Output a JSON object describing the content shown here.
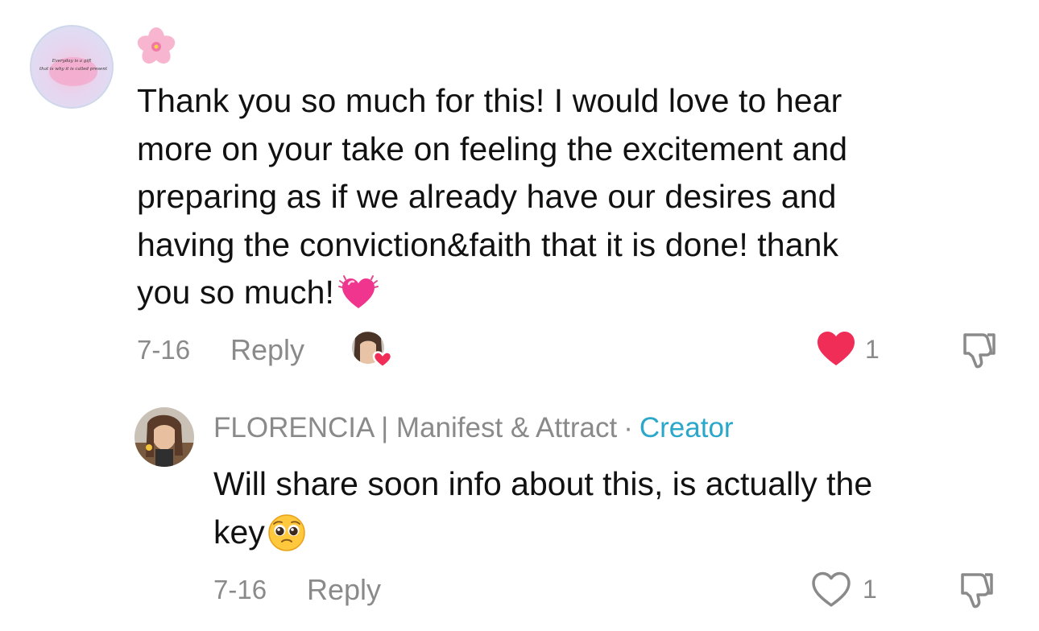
{
  "comment": {
    "avatar_text": "Everyday is a gift that is why it is called present",
    "flower_icon": "cherry-blossom-emoji",
    "lines": [
      "Thank you so much for this! I would love to hear",
      "more on your take on feeling the excitement and",
      "preparing as if we already have our desires and",
      "having the conviction&faith that it is done! thank",
      "you so much!"
    ],
    "trailing_emoji": "growing-heart-emoji",
    "date": "7-16",
    "reply_label": "Reply",
    "liked_by_creator_icon": "creator-liked-avatar",
    "like_count": "1",
    "liked": true,
    "like_color": "#ef2d56"
  },
  "reply": {
    "author": "FLORENCIA | Manifest & Attract",
    "separator": "·",
    "badge": "Creator",
    "badge_color": "#2aa7c9",
    "lines": [
      "Will share soon info about this, is actually the",
      "key"
    ],
    "trailing_emoji": "pleading-face-emoji",
    "date": "7-16",
    "reply_label": "Reply",
    "like_count": "1",
    "liked": false
  }
}
